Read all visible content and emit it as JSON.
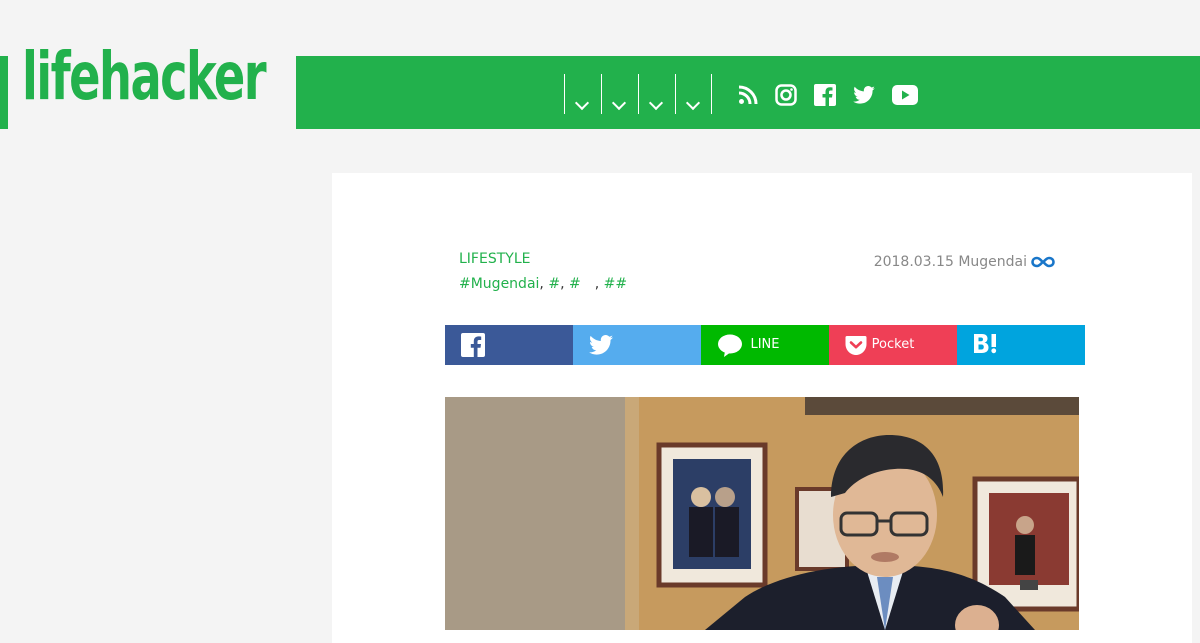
{
  "site": {
    "logo_text": "lifehacker"
  },
  "nav": {
    "dropdowns": [
      "",
      "",
      "",
      ""
    ],
    "social_icons": [
      "rss-icon",
      "instagram-icon",
      "facebook-icon",
      "twitter-icon",
      "youtube-icon"
    ]
  },
  "article": {
    "category": "LIFESTYLE",
    "tags": [
      "#Mugendai",
      "#",
      "#",
      "#",
      "#"
    ],
    "tag_separators": [
      ", ",
      ", ",
      "　, ",
      ""
    ],
    "date": "2018.03.15",
    "source": "Mugendai",
    "source_icon": "infinity-icon"
  },
  "share": {
    "facebook_label": "",
    "twitter_label": "",
    "line_label": "LINE",
    "pocket_label": "Pocket",
    "hatena_label": ""
  },
  "colors": {
    "brand_green": "#22b14c",
    "facebook": "#3b5998",
    "twitter": "#55acee",
    "line": "#00b900",
    "pocket": "#ef3f56",
    "hatena": "#00a4de"
  }
}
